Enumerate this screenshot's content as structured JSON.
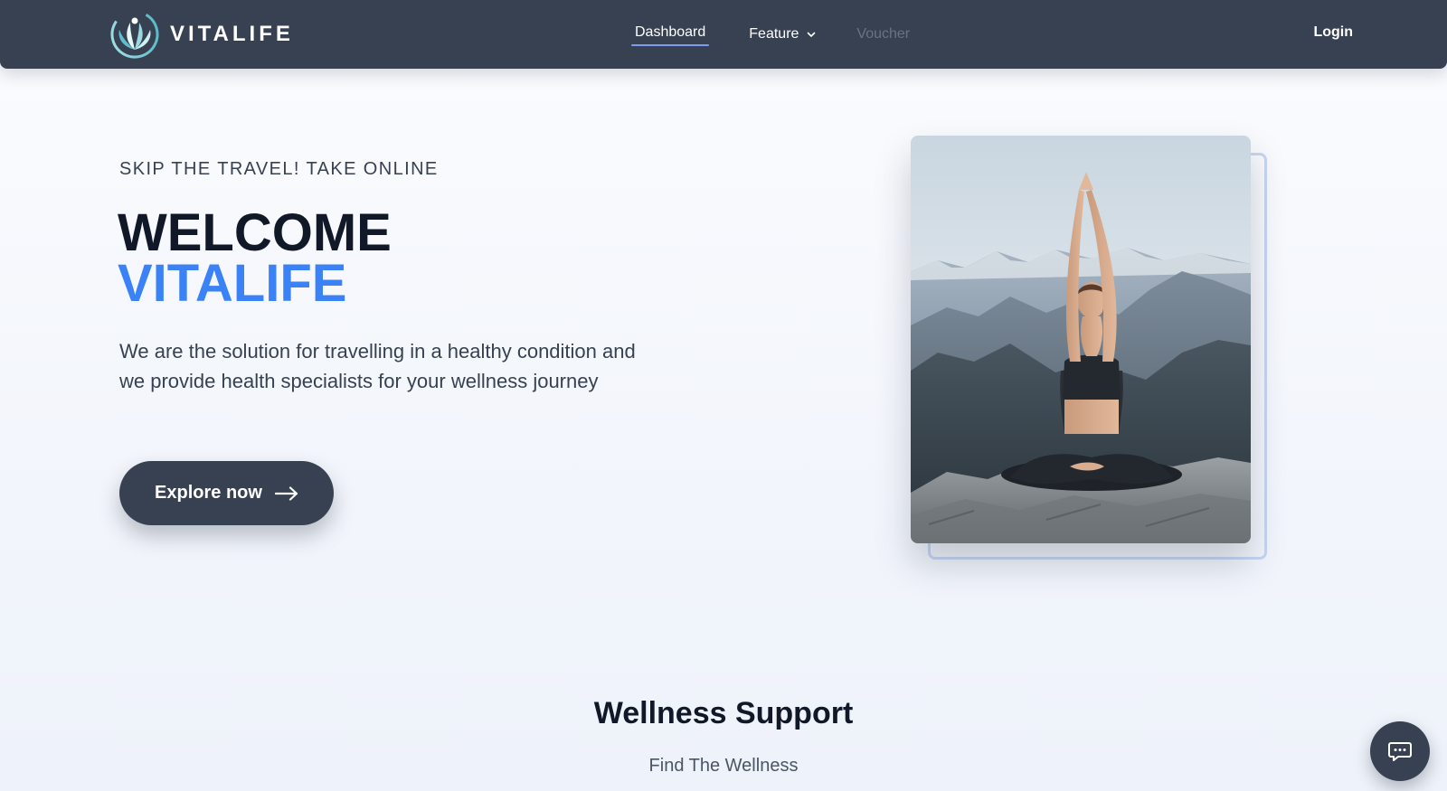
{
  "brand": {
    "name": "VITALIFE",
    "logo_icon": "lotus-figure-logo"
  },
  "nav": {
    "links": [
      {
        "label": "Dashboard",
        "state": "active"
      },
      {
        "label": "Feature",
        "state": "dropdown"
      },
      {
        "label": "Voucher",
        "state": "disabled"
      }
    ],
    "login_label": "Login"
  },
  "hero": {
    "eyebrow": "SKIP THE TRAVEL! TAKE ONLINE",
    "title_line1": "WELCOME",
    "title_line2": "VITALIFE",
    "description": "We are the solution for travelling in a healthy condition and we provide health specialists for your wellness journey",
    "cta_label": "Explore now",
    "cta_icon": "arrow-right-icon",
    "image": "woman meditating in yoga pose on mountain rock"
  },
  "section": {
    "title": "Wellness Support",
    "subtitle": "Find The Wellness"
  },
  "chat": {
    "icon": "chat-bubble-icon"
  },
  "colors": {
    "navbar": "#374151",
    "accent_blue": "#3b82f6",
    "text_dark": "#111827",
    "nav_underline": "#7c9cf0",
    "card_outline": "#c7d6f3"
  }
}
